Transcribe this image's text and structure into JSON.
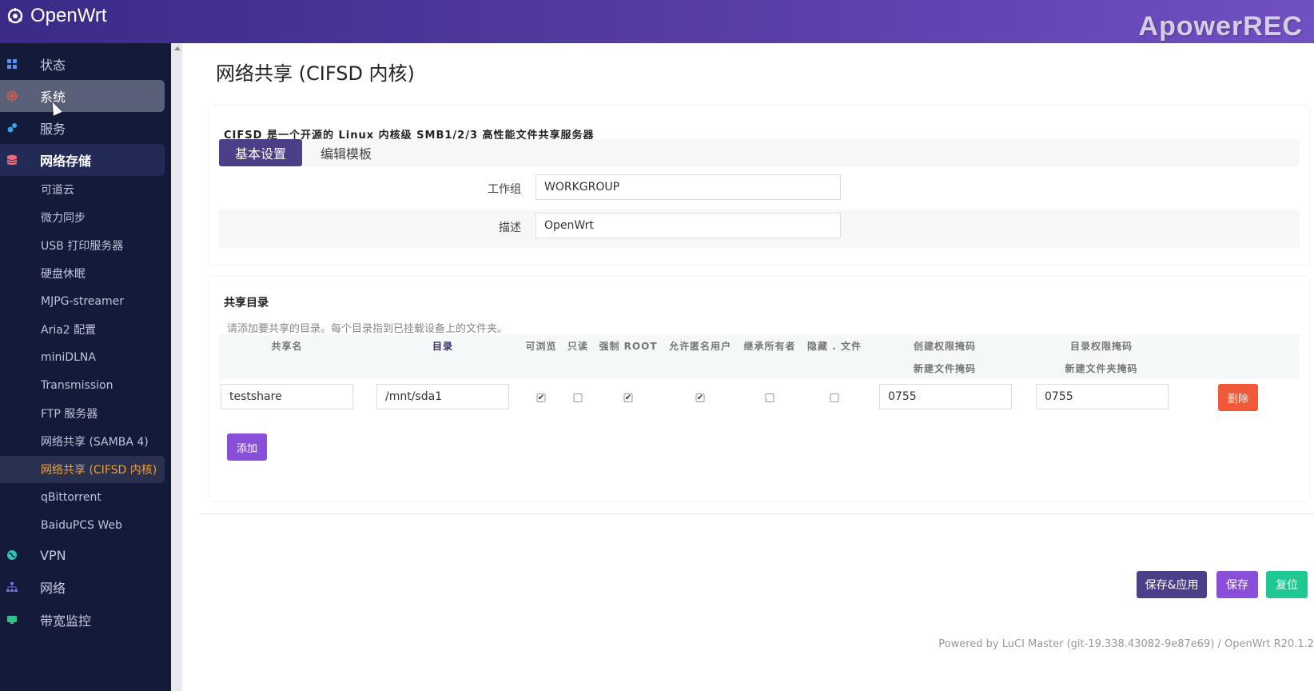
{
  "header": {
    "brand": "OpenWrt",
    "watermark": "ApowerREC"
  },
  "colors": {
    "header_start": "#3b2a86",
    "header_end": "#7150c2",
    "sidebar_bg": "#141a3a",
    "active_menu_text": "#f0a030",
    "primary_button": "#4c3f87",
    "save_button": "#8a4fd9",
    "reset_button": "#1fc891",
    "delete_button": "#f05a3a"
  },
  "sidebar": {
    "items": [
      {
        "label": "状态",
        "icon": "dashboard-icon"
      },
      {
        "label": "系统",
        "icon": "gear-icon"
      },
      {
        "label": "服务",
        "icon": "services-icon"
      },
      {
        "label": "网络存储",
        "icon": "database-icon"
      }
    ],
    "sub_items": [
      "可道云",
      "微力同步",
      "USB 打印服务器",
      "硬盘休眠",
      "MJPG-streamer",
      "Aria2 配置",
      "miniDLNA",
      "Transmission",
      "FTP 服务器",
      "网络共享 (SAMBA 4)",
      "网络共享 (CIFSD 内核)",
      "qBittorrent",
      "BaiduPCS Web"
    ],
    "bottom_items": [
      {
        "label": "VPN",
        "icon": "globe-icon"
      },
      {
        "label": "网络",
        "icon": "network-icon"
      },
      {
        "label": "带宽监控",
        "icon": "monitor-icon"
      }
    ]
  },
  "main": {
    "title": "网络共享 (CIFSD 内核)",
    "description": "CIFSD 是一个开源的 Linux 内核级 SMB1/2/3 高性能文件共享服务器",
    "tabs": [
      "基本设置",
      "编辑模板"
    ],
    "form": {
      "workgroup_label": "工作组",
      "workgroup_value": "WORKGROUP",
      "desc_label": "描述",
      "desc_value": "OpenWrt"
    },
    "shares": {
      "title": "共享目录",
      "hint": "请添加要共享的目录。每个目录指到已挂载设备上的文件夹。",
      "columns": {
        "name": "共享名",
        "path": "目录",
        "browseable": "可浏览",
        "readonly": "只读",
        "force_root": "强制 ROOT",
        "guest_ok": "允许匿名用户",
        "inherit_owner": "继承所有者",
        "hide_dot": "隐藏 . 文件",
        "create_mask": "创建权限掩码",
        "create_mask_sub": "新建文件掩码",
        "dir_mask": "目录权限掩码",
        "dir_mask_sub": "新建文件夹掩码"
      },
      "rows": [
        {
          "name": "testshare",
          "path": "/mnt/sda1",
          "browseable": "✔",
          "readonly": "",
          "force_root": "✔",
          "guest_ok": "✔",
          "inherit_owner": "",
          "hide_dot": "",
          "create_mask": "0755",
          "dir_mask": "0755"
        }
      ],
      "delete_label": "删除",
      "add_label": "添加"
    },
    "actions": {
      "save_apply": "保存&应用",
      "save": "保存",
      "reset": "复位"
    },
    "footer": "Powered by LuCI Master (git-19.338.43082-9e87e69) / OpenWrt R20.1.2"
  }
}
